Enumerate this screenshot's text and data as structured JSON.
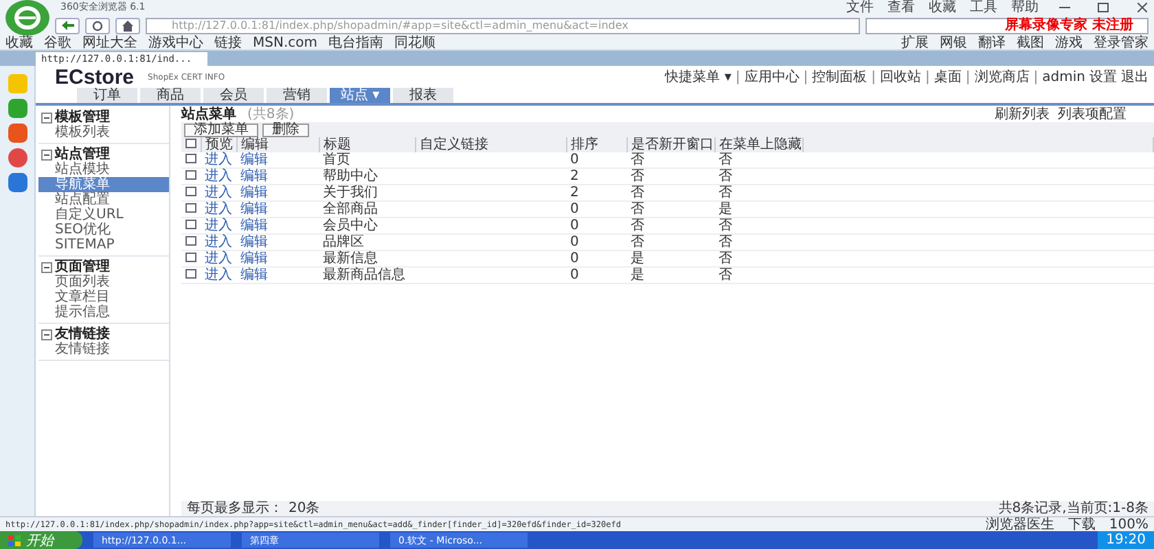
{
  "browser": {
    "title": "360安全浏览器 6.1",
    "menu": [
      "文件",
      "查看",
      "收藏",
      "工具",
      "帮助"
    ],
    "address": "http://127.0.0.1:81/index.php/shopadmin/#app=site&ctl=admin_menu&act=index",
    "search_banner": "屏幕录像专家 未注册",
    "bookmarks": [
      "收藏",
      "谷歌",
      "网址大全",
      "游戏中心",
      "链接",
      "MSN.com",
      "电台指南",
      "同花顺"
    ],
    "tools": [
      "扩展",
      "网银",
      "翻译",
      "截图",
      "游戏",
      "登录管家"
    ],
    "tabs": [
      {
        "label": "http://127.0.0.1:81/ind...",
        "selected": true
      }
    ],
    "status_url": "http://127.0.0.1:81/index.php/shopadmin/index.php?app=site&ctl=admin_menu&act=add&_finder[finder_id]=320efd&finder_id=320efd",
    "status_items": [
      "浏览器医生",
      "下载",
      "100%"
    ]
  },
  "app": {
    "logo": "ECstore",
    "logo_sub": "ShopEx CERT INFO",
    "top_links": [
      "快捷菜单 ▾",
      "应用中心",
      "控制面板",
      "回收站",
      "桌面",
      "浏览商店"
    ],
    "separator": "|",
    "user": "admin",
    "user_links": [
      "设置",
      "退出"
    ],
    "nav": [
      {
        "label": "订单",
        "selected": false
      },
      {
        "label": "商品",
        "selected": false
      },
      {
        "label": "会员",
        "selected": false
      },
      {
        "label": "营销",
        "selected": false
      },
      {
        "label": "站点 ▾",
        "selected": true
      },
      {
        "label": "报表",
        "selected": false
      }
    ]
  },
  "sidebar": [
    {
      "title": "模板管理",
      "expanded": true,
      "items": [
        {
          "label": "模板列表",
          "selected": false
        }
      ]
    },
    {
      "title": "站点管理",
      "expanded": true,
      "items": [
        {
          "label": "站点模块",
          "selected": false
        },
        {
          "label": "导航菜单",
          "selected": true
        },
        {
          "label": "站点配置",
          "selected": false
        },
        {
          "label": "自定义URL",
          "selected": false
        },
        {
          "label": "SEO优化",
          "selected": false
        },
        {
          "label": "SITEMAP",
          "selected": false
        }
      ]
    },
    {
      "title": "页面管理",
      "expanded": true,
      "items": [
        {
          "label": "页面列表",
          "selected": false
        },
        {
          "label": "文章栏目",
          "selected": false
        },
        {
          "label": "提示信息",
          "selected": false
        }
      ]
    },
    {
      "title": "友情链接",
      "expanded": true,
      "items": [
        {
          "label": "友情链接",
          "selected": false
        }
      ]
    }
  ],
  "content": {
    "title": "站点菜单",
    "count": "(共8条)",
    "actions": [
      "刷新列表",
      "列表项配置"
    ],
    "buttons": [
      "添加菜单",
      "删除"
    ],
    "select_all_checked": false,
    "columns": [
      "预览",
      "编辑",
      "标题",
      "自定义链接",
      "排序",
      "是否新开窗口",
      "在菜单上隐藏"
    ],
    "rows": [
      {
        "checked": false,
        "preview": "进入",
        "edit": "编辑",
        "title": "首页",
        "sort": "0",
        "new_window": "否",
        "hidden": "否"
      },
      {
        "checked": false,
        "preview": "进入",
        "edit": "编辑",
        "title": "帮助中心",
        "sort": "2",
        "new_window": "否",
        "hidden": "否"
      },
      {
        "checked": false,
        "preview": "进入",
        "edit": "编辑",
        "title": "关于我们",
        "sort": "2",
        "new_window": "否",
        "hidden": "否"
      },
      {
        "checked": false,
        "preview": "进入",
        "edit": "编辑",
        "title": "全部商品",
        "sort": "0",
        "new_window": "否",
        "hidden": "是"
      },
      {
        "checked": false,
        "preview": "进入",
        "edit": "编辑",
        "title": "会员中心",
        "sort": "0",
        "new_window": "否",
        "hidden": "否"
      },
      {
        "checked": false,
        "preview": "进入",
        "edit": "编辑",
        "title": "品牌区",
        "sort": "0",
        "new_window": "否",
        "hidden": "否"
      },
      {
        "checked": false,
        "preview": "进入",
        "edit": "编辑",
        "title": "最新信息",
        "sort": "0",
        "new_window": "是",
        "hidden": "否"
      },
      {
        "checked": false,
        "preview": "进入",
        "edit": "编辑",
        "title": "最新商品信息",
        "sort": "0",
        "new_window": "是",
        "hidden": "否"
      }
    ],
    "page_size_label": "每页最多显示：",
    "page_size": "20条",
    "summary": "共8条记录,当前页:1-8条"
  },
  "taskbar": {
    "start": "开始",
    "items": [
      "http://127.0.0.1...",
      "第四章",
      "0.软文 - Microso..."
    ],
    "clock": "19:20"
  }
}
